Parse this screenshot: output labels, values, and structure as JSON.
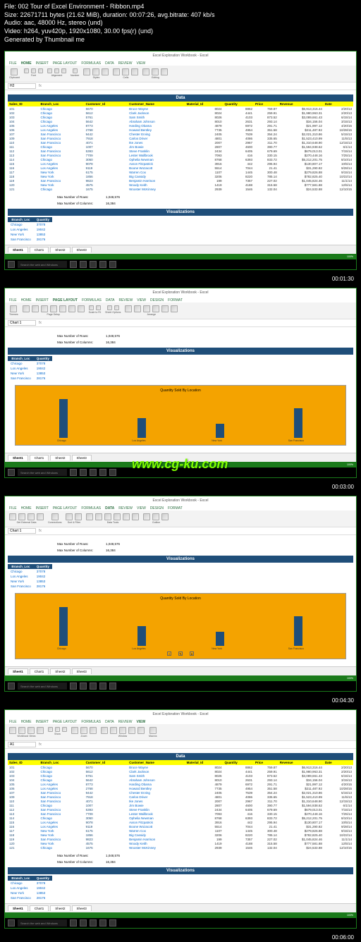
{
  "meta": {
    "file": "File: 002 Tour of Excel Environment - Ribbon.mp4",
    "size": "Size: 22671711 bytes (21.62 MiB), duration: 00:07:26, avg.bitrate: 407 kb/s",
    "audio": "Audio: aac, 48000 Hz, stereo (und)",
    "video": "Video: h264, yuv420p, 1920x1080, 30.00 fps(r) (und)",
    "gen": "Generated by Thumbnail me"
  },
  "timestamps": [
    "00:01:30",
    "00:03:00",
    "00:04:30",
    "00:06:00"
  ],
  "watermark": "www.cg-ku.com",
  "excel": {
    "title": "Excel Exploration Workbook - Excel",
    "tabs": [
      "FILE",
      "HOME",
      "INSERT",
      "PAGE LAYOUT",
      "FORMULAS",
      "DATA",
      "REVIEW",
      "VIEW"
    ],
    "chart_tabs": [
      "DESIGN",
      "FORMAT"
    ],
    "sheets": [
      "Sheet1",
      "Chart1",
      "Sheet2",
      "Sheet3"
    ],
    "data_header": "Data",
    "viz_header": "Visualizations",
    "columns": [
      "Sales_ID",
      "Branch_Loc",
      "Customer_Id",
      "Customer_Name",
      "Material_Id",
      "Quantity",
      "Price",
      "Revenue",
      "Date"
    ],
    "rows": [
      [
        "101",
        "Chicago",
        "5670",
        "Bruce Wayne",
        "8024",
        "8862",
        "759.87",
        "$6,913,316.44",
        "2/20/13"
      ],
      [
        "102",
        "Chicago",
        "5612",
        "Clark Jackson",
        "8024",
        "4441",
        "259.91",
        "$1,980,963.31",
        "2/20/13"
      ],
      [
        "103",
        "Chicago",
        "5761",
        "Sam Smith",
        "8026",
        "4103",
        "873.52",
        "$3,089,661.43",
        "6/15/14"
      ],
      [
        "104",
        "Chicago",
        "5642",
        "Abraham Johnson",
        "8010",
        "2631",
        "293.14",
        "$34,156.04",
        "3/15/13"
      ],
      [
        "105",
        "Los Angeles",
        "8773",
        "Harding Obama",
        "4879",
        "6972",
        "291.71",
        "$21,997.12",
        "4/20/15"
      ],
      [
        "106",
        "Los Angeles",
        "2768",
        "Howard Bentley",
        "7735",
        "4954",
        "351.58",
        "$211,487.92",
        "10/28/15"
      ],
      [
        "107",
        "San Francisco",
        "9442",
        "Chester Erving",
        "2405",
        "7539",
        "354.24",
        "$2,021,310.86",
        "5/15/13"
      ],
      [
        "109",
        "San Francisco",
        "7918",
        "Carlos Driver",
        "4801",
        "4086",
        "335.65",
        "$1,523,410.99",
        "11/5/13"
      ],
      [
        "110",
        "San Francisco",
        "4071",
        "Ike Jones",
        "2007",
        "2967",
        "311.70",
        "$1,310,648.90",
        "12/15/13"
      ],
      [
        "111",
        "Chicago",
        "1007",
        "Jim Bowie",
        "2807",
        "4600",
        "390.77",
        "$1,594,938.62",
        "6/1/14"
      ],
      [
        "112",
        "San Francisco",
        "5393",
        "Steve Franklin",
        "2434",
        "6405",
        "679.69",
        "$679,013.01",
        "7/15/14"
      ],
      [
        "113",
        "San Francisco",
        "7709",
        "Lester Wallbrook",
        "7093",
        "416",
        "330.15",
        "$270,448.16",
        "7/25/14"
      ],
      [
        "114",
        "Chicago",
        "3050",
        "Ophelia Newman",
        "8768",
        "6393",
        "833.72",
        "$5,212,201.75",
        "8/10/14"
      ],
      [
        "115",
        "Los Angeles",
        "9078",
        "Aaron Fitzpatrick",
        "3916",
        "442",
        "295.94",
        "$130,807.17",
        "10/5/14"
      ],
      [
        "116",
        "Los Angeles",
        "9119",
        "Boone Wozacott",
        "5514",
        "7044",
        "21.41",
        "$31,290.82",
        "9/28/14"
      ],
      [
        "117",
        "New York",
        "6175",
        "Warren Cox",
        "1107",
        "1445",
        "300.48",
        "$279,826.88",
        "9/15/14"
      ],
      [
        "118",
        "New York",
        "1856",
        "Big Cassidy",
        "3206",
        "8220",
        "785.14",
        "$782,825.40",
        "10/22/14"
      ],
      [
        "119",
        "San Francisco",
        "9823",
        "Benjamin Harrison",
        "199",
        "7357",
        "227.02",
        "$1,045,824.46",
        "11/1/14"
      ],
      [
        "120",
        "New York",
        "4575",
        "Woody Keith",
        "1419",
        "4188",
        "315.58",
        "$777,581.88",
        "12/5/14"
      ],
      [
        "121",
        "Chicago",
        "1675",
        "Wooster McKinney",
        "2939",
        "1546",
        "132.04",
        "$24,533.88",
        "12/10/15"
      ]
    ],
    "summary": {
      "rows_label": "Max Number of Rows:",
      "rows_val": "1,048,576",
      "cols_label": "Max Number of Columns:",
      "cols_val": "16,384"
    },
    "filter": {
      "header_a": "Branch_Loc",
      "header_b": "Quantity",
      "rows": [
        [
          "Chicago",
          "37078"
        ],
        [
          "Los Angeles",
          "19042"
        ],
        [
          "New York",
          "13853"
        ],
        [
          "San Francisco",
          "28176"
        ]
      ]
    },
    "search_placeholder": "Search the web and Windows"
  },
  "chart_data": {
    "type": "bar",
    "title": "Quantity Sold By Location",
    "categories": [
      "Chicago",
      "Los Angeles",
      "New York",
      "San Francisco"
    ],
    "values": [
      37078,
      19042,
      13853,
      28176
    ],
    "ylim": [
      0,
      40000
    ],
    "ylabel": "",
    "xlabel": ""
  }
}
